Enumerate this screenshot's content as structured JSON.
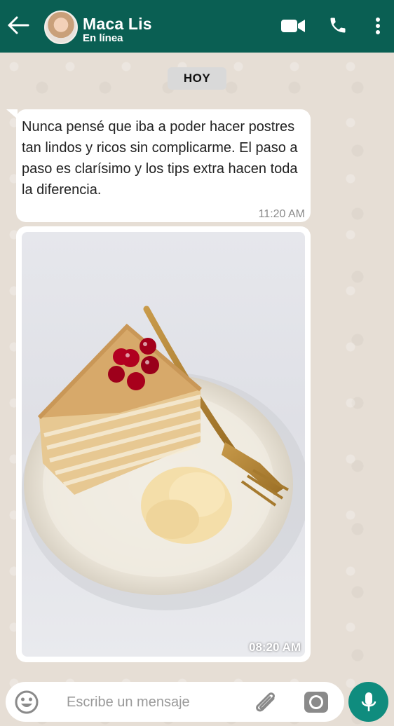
{
  "header": {
    "contact_name": "Maca Lis",
    "status": "En línea"
  },
  "date_divider": "HOY",
  "messages": [
    {
      "text": "Nunca pensé que iba a poder hacer postres tan lindos y ricos sin complicarme. El paso a paso es clarísimo y los tips extra hacen toda la diferencia.",
      "time": "11:20 AM"
    },
    {
      "type": "image",
      "time": "08:20 AM"
    }
  ],
  "composer": {
    "placeholder": "Escribe un mensaje"
  },
  "colors": {
    "header": "#0a5f53",
    "chat_background": "#e6ded5",
    "mic_button": "#0f8c7e"
  },
  "icons": [
    "back-arrow-icon",
    "video-call-icon",
    "phone-icon",
    "more-menu-icon",
    "emoji-icon",
    "attach-icon",
    "camera-icon",
    "mic-icon"
  ]
}
